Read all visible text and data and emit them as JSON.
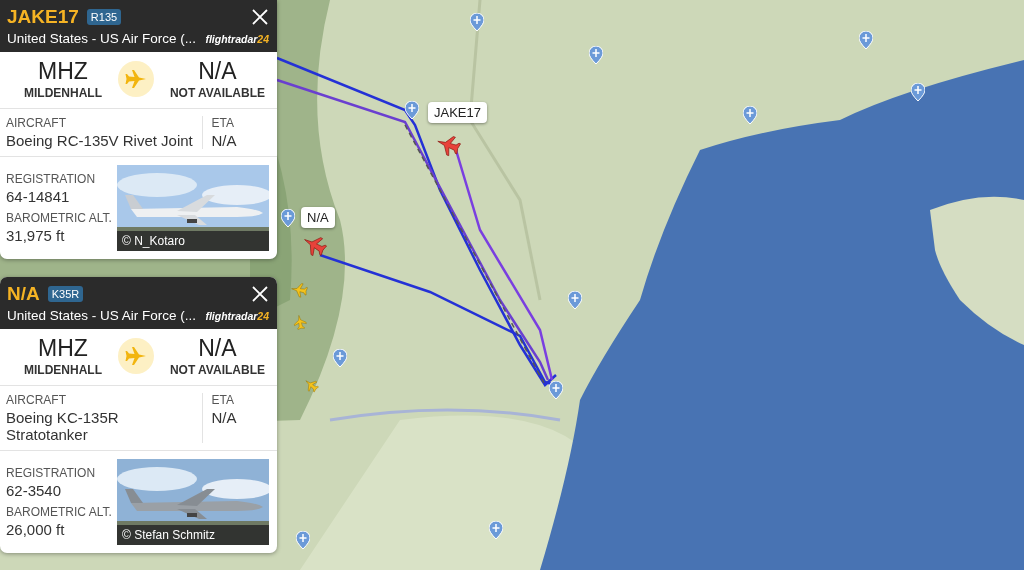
{
  "flights": [
    {
      "callsign": "JAKE17",
      "type_code": "R135",
      "operator": "United States - US Air Force (...",
      "logo_name": "flightradar",
      "logo_suffix": "24",
      "origin": {
        "code": "MHZ",
        "name": "MILDENHALL"
      },
      "destination": {
        "code": "N/A",
        "name": "NOT AVAILABLE"
      },
      "aircraft_label": "AIRCRAFT",
      "aircraft": [
        "Boeing RC-135V Rivet Joint"
      ],
      "eta_label": "ETA",
      "eta": "N/A",
      "registration_label": "REGISTRATION",
      "registration": "64-14841",
      "altitude_label": "BAROMETRIC ALT.",
      "altitude": "31,975 ft",
      "photo": {
        "kind": "picture",
        "credit": "© N_Kotaro"
      }
    },
    {
      "callsign": "N/A",
      "type_code": "K35R",
      "operator": "United States - US Air Force (...",
      "logo_name": "flightradar",
      "logo_suffix": "24",
      "origin": {
        "code": "MHZ",
        "name": "MILDENHALL"
      },
      "destination": {
        "code": "N/A",
        "name": "NOT AVAILABLE"
      },
      "aircraft_label": "AIRCRAFT",
      "aircraft": [
        "Boeing KC-135R",
        "Stratotanker"
      ],
      "eta_label": "ETA",
      "eta": "N/A",
      "registration_label": "REGISTRATION",
      "registration": "62-3540",
      "altitude_label": "BAROMETRIC ALT.",
      "altitude": "26,000 ft",
      "photo": {
        "kind": "picture",
        "credit": "© Stefan Schmitz"
      }
    }
  ],
  "map": {
    "kind": "picture",
    "aircraft": [
      {
        "label": "JAKE17",
        "selected": true
      },
      {
        "label": "N/A",
        "selected": true
      },
      {
        "selected": false
      },
      {
        "selected": false
      },
      {
        "selected": false
      }
    ]
  }
}
